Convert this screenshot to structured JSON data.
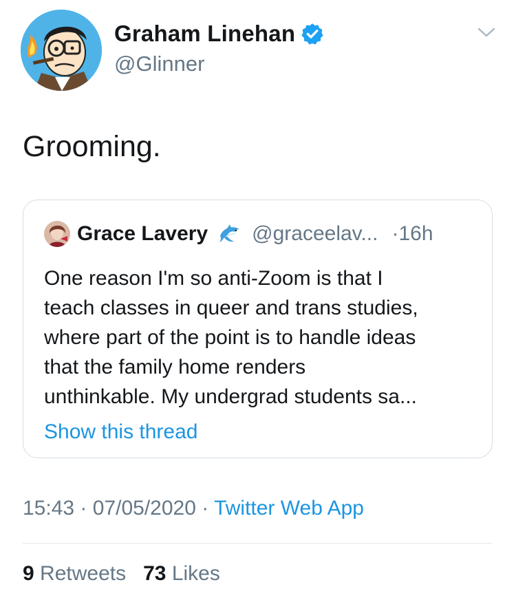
{
  "author": {
    "name": "Graham Linehan",
    "handle": "@Glinner",
    "verified": true
  },
  "tweet": {
    "text": "Grooming."
  },
  "quoted_tweet": {
    "name": "Grace Lavery",
    "handle": "@graceelav...",
    "separator": "·",
    "time": "16h",
    "lines": [
      "One reason I'm so anti-Zoom is that I",
      "teach classes in queer and trans studies,",
      "where part of the point is to handle ideas",
      "that the family home renders",
      "unthinkable. My undergrad students sa..."
    ],
    "show_thread": "Show this thread"
  },
  "meta": {
    "time": "15:43",
    "sep1": "·",
    "date": "07/05/2020",
    "sep2": "·",
    "source": "Twitter Web App"
  },
  "stats": {
    "retweets_count": "9",
    "retweets_label": "Retweets",
    "likes_count": "73",
    "likes_label": "Likes"
  },
  "colors": {
    "link": "#1b95e0",
    "secondary_text": "#657786",
    "verified_badge": "#1da1f2"
  }
}
